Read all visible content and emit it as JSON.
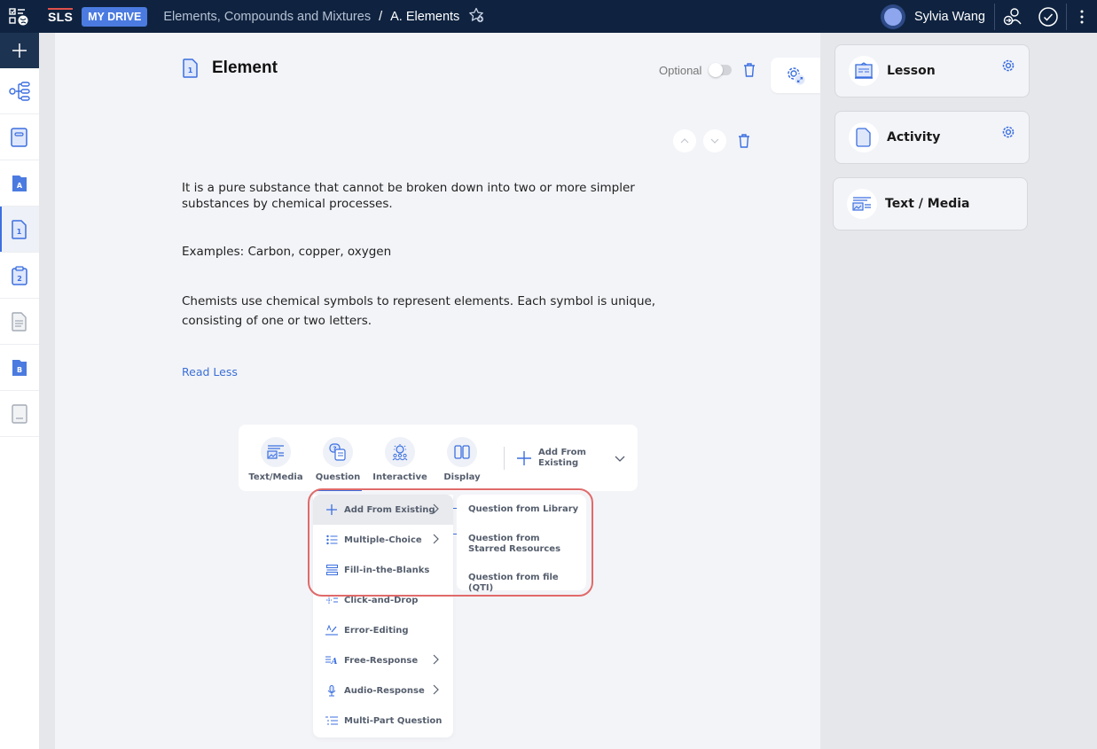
{
  "topbar": {
    "logo": "SLS",
    "drive_badge": "MY DRIVE",
    "breadcrumb_parent": "Elements, Compounds and Mixtures",
    "breadcrumb_separator": "/",
    "breadcrumb_current": "A. Elements",
    "user_name": "Sylvia Wang",
    "icons": [
      "apps-icon",
      "favorite-add-icon",
      "avatar",
      "switch-user-icon",
      "check-circle-icon",
      "more-vertical-icon"
    ]
  },
  "rail": {
    "items": [
      {
        "name": "add",
        "icon": "plus-icon"
      },
      {
        "name": "lesson-map",
        "icon": "tree-settings-icon"
      },
      {
        "name": "lesson",
        "icon": "book-icon"
      },
      {
        "name": "section-a",
        "icon": "folder-a-icon",
        "label": "A"
      },
      {
        "name": "activity-1",
        "icon": "page-1-icon",
        "label": "1",
        "active": true
      },
      {
        "name": "activity-2",
        "icon": "clipboard-2-icon",
        "label": "2"
      },
      {
        "name": "document",
        "icon": "document-icon"
      },
      {
        "name": "section-b",
        "icon": "folder-b-icon",
        "label": "B"
      },
      {
        "name": "notebook",
        "icon": "notebook-icon"
      }
    ]
  },
  "element": {
    "title": "Element",
    "badge": "1",
    "optional_label": "Optional",
    "optional_on": false,
    "paragraphs": [
      "It is a pure substance that cannot be broken down into two or more simpler substances by chemical processes.",
      "Examples: Carbon, copper, oxygen",
      "Chemists use chemical symbols to represent elements. Each symbol is unique, consisting of one or two letters."
    ],
    "read_less": "Read Less"
  },
  "add_toolbar": {
    "items": [
      {
        "label": "Text/Media",
        "icon": "text-media-icon"
      },
      {
        "label": "Question",
        "icon": "question-icon"
      },
      {
        "label": "Interactive",
        "icon": "interactive-icon"
      },
      {
        "label": "Display",
        "icon": "display-icon"
      }
    ],
    "add_existing": "Add From Existing"
  },
  "question_menu": {
    "items": [
      {
        "label": "Add From Existing",
        "icon": "plus-icon",
        "submenu": true,
        "highlighted": true
      },
      {
        "label": "Multiple-Choice",
        "icon": "list-icon",
        "submenu": true
      },
      {
        "label": "Fill-in-the-Blanks",
        "icon": "blanks-icon",
        "submenu": false
      },
      {
        "label": "Click-and-Drop",
        "icon": "drag-drop-icon",
        "submenu": false
      },
      {
        "label": "Error-Editing",
        "icon": "error-edit-icon",
        "submenu": false
      },
      {
        "label": "Free-Response",
        "icon": "free-response-icon",
        "submenu": true
      },
      {
        "label": "Audio-Response",
        "icon": "microphone-icon",
        "submenu": true
      },
      {
        "label": "Multi-Part Question",
        "icon": "multipart-icon",
        "submenu": false
      }
    ],
    "submenu": [
      "Question from Library",
      "Question from Starred Resources",
      "Question from file (QTI)"
    ]
  },
  "right_panel": {
    "cards": [
      {
        "label": "Lesson",
        "icon": "lesson-icon",
        "settings": true
      },
      {
        "label": "Activity",
        "icon": "activity-icon",
        "settings": true
      },
      {
        "label": "Text / Media",
        "icon": "text-media-icon",
        "settings": false
      }
    ]
  },
  "colors": {
    "topbar": "#0f2340",
    "accent": "#3b6fe0",
    "badge": "#4b7be0",
    "highlight_border": "#e06a6a"
  }
}
